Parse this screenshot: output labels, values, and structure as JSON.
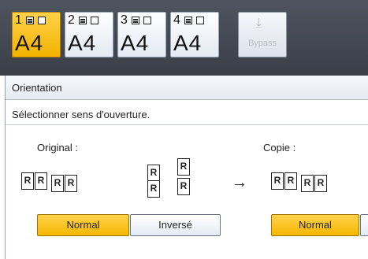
{
  "trays": [
    {
      "number": "1",
      "size": "A4",
      "selected": true
    },
    {
      "number": "2",
      "size": "A4",
      "selected": false
    },
    {
      "number": "3",
      "size": "A4",
      "selected": false
    },
    {
      "number": "4",
      "size": "A4",
      "selected": false
    }
  ],
  "bypass": {
    "label": "Bypass",
    "icon": "tray-arrow-down-icon"
  },
  "panel": {
    "title": "Orientation",
    "instruction": "Sélectionner sens d'ouverture.",
    "original_label": "Original :",
    "copy_label": "Copie :"
  },
  "doc_letter": "R",
  "arrow": "→",
  "buttons": {
    "original_normal": "Normal",
    "original_inverse": "Inversé",
    "copy_normal": "Normal"
  },
  "colors": {
    "accent": "#f5b800",
    "topbar": "#3a3f48"
  }
}
